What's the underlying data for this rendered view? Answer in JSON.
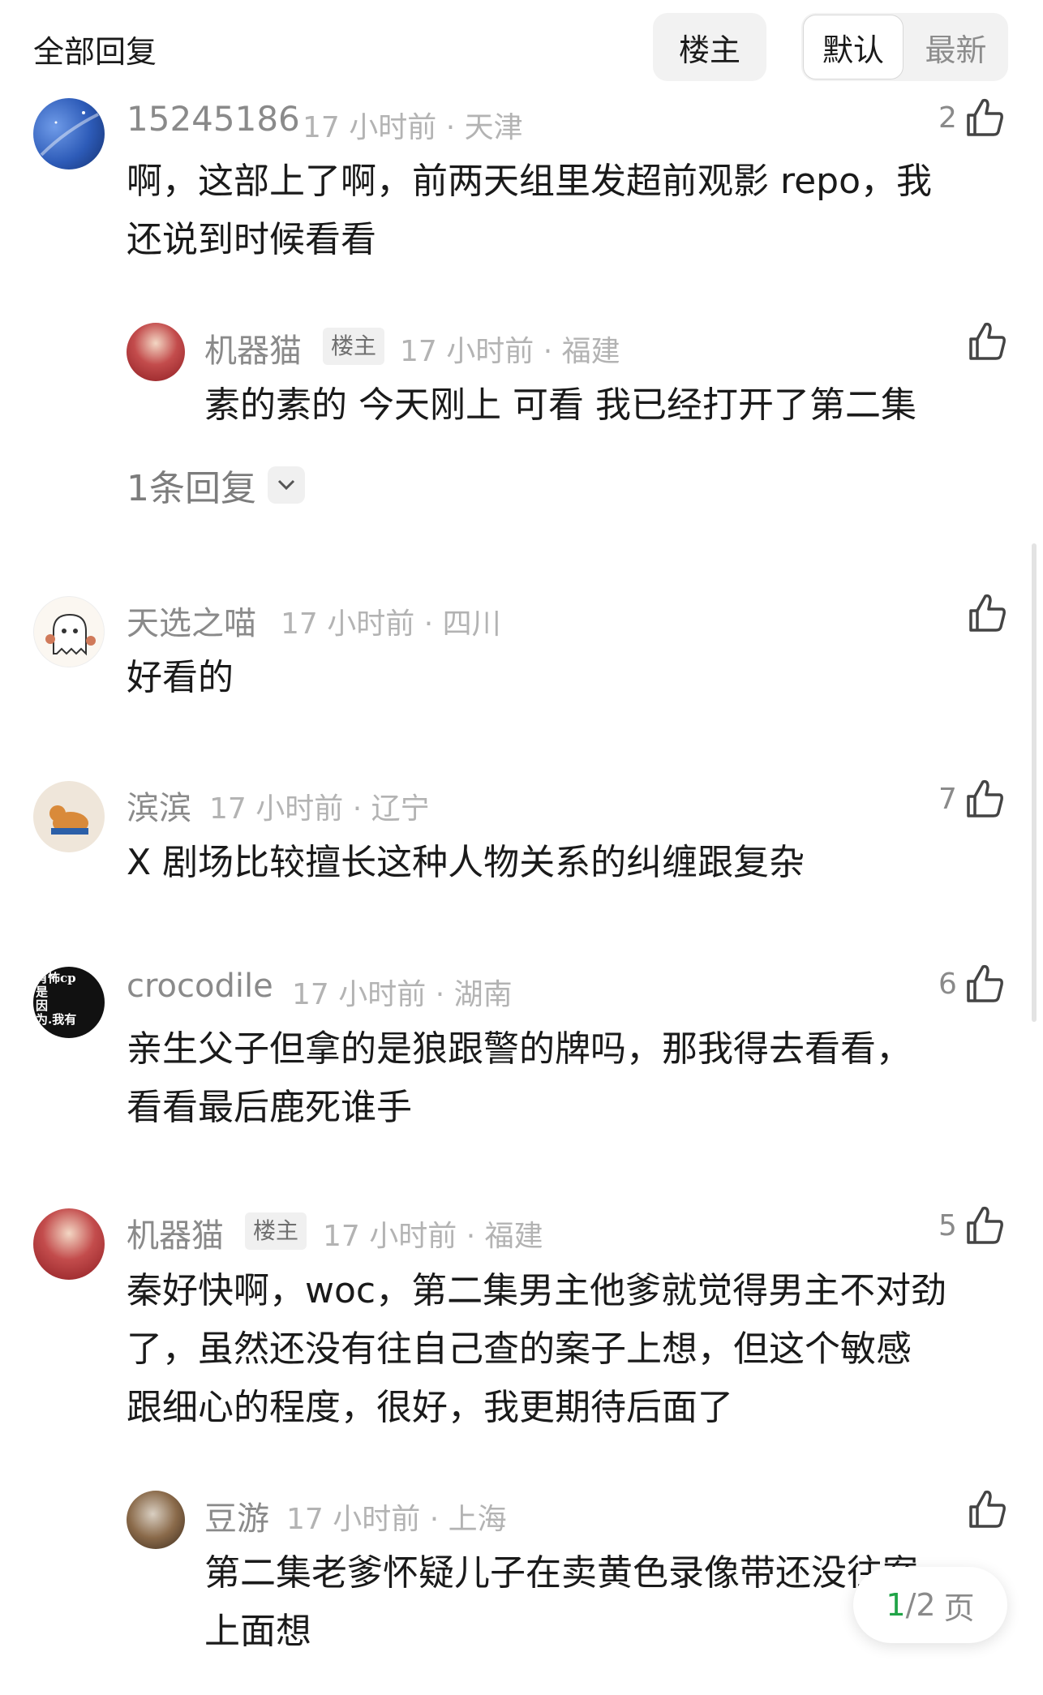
{
  "header": {
    "title": "全部回复",
    "filter_op_label": "楼主",
    "sort_default_label": "默认",
    "sort_latest_label": "最新"
  },
  "colors": {
    "text_primary": "#1a1a1a",
    "text_secondary": "#8a8a8a",
    "text_meta": "#b3b3b3",
    "badge_bg": "#f0f0f0",
    "pager_current": "#20a447"
  },
  "comments": [
    {
      "user": "15245186",
      "meta": "17 小时前 · 天津",
      "likes": "2",
      "lines": [
        "啊，这部上了啊，前两天组里发超前观影 repo，我",
        "还说到时候看看"
      ],
      "reply": {
        "user": "机器猫",
        "badge": "楼主",
        "meta": "17 小时前 · 福建",
        "lines": [
          "素的素的 今天刚上 可看 我已经打开了第二集"
        ]
      },
      "more_replies_label": "1条回复"
    },
    {
      "user": "天选之喵",
      "meta": "17 小时前 · 四川",
      "likes": "",
      "lines": [
        "好看的"
      ]
    },
    {
      "user": "滨滨",
      "meta": "17 小时前 · 辽宁",
      "likes": "7",
      "lines": [
        "X 剧场比较擅长这种人物关系的纠缠跟复杂"
      ]
    },
    {
      "user": "crocodile",
      "meta": "17 小时前 · 湖南",
      "likes": "6",
      "avatar_text": [
        "肖怖cp",
        "是",
        "因",
        "为.我有"
      ],
      "lines": [
        "亲生父子但拿的是狼跟警的牌吗，那我得去看看，",
        "看看最后鹿死谁手"
      ]
    },
    {
      "user": "机器猫",
      "badge": "楼主",
      "meta": "17 小时前 · 福建",
      "likes": "5",
      "lines": [
        "秦好快啊，woc，第二集男主他爹就觉得男主不对劲",
        "了，虽然还没有往自己查的案子上想，但这个敏感",
        "跟细心的程度，很好，我更期待后面了"
      ],
      "reply": {
        "user": "豆游",
        "meta": "17 小时前 · 上海",
        "lines": [
          "第二集老爹怀疑儿子在卖黄色录像带还没往案",
          "上面想"
        ]
      }
    }
  ],
  "pager": {
    "current": "1",
    "total": "2",
    "unit": "页",
    "sep": "/"
  }
}
